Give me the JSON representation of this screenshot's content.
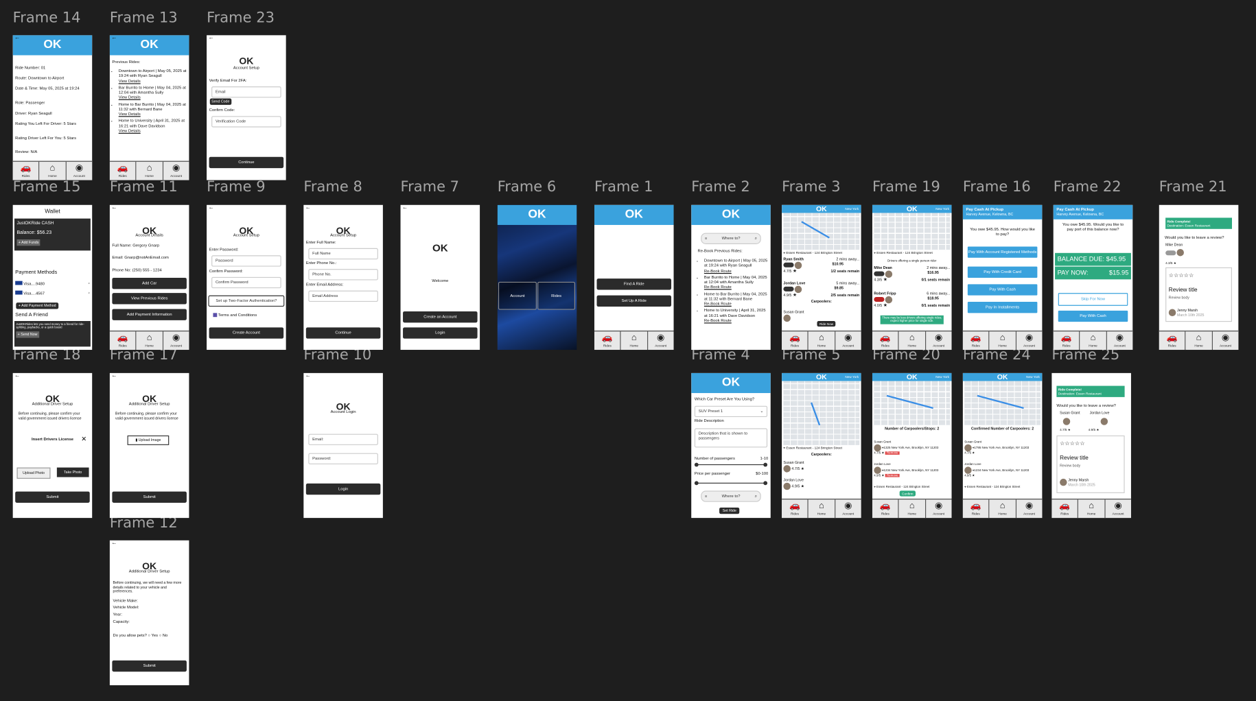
{
  "labels": {
    "f14": "Frame 14",
    "f13": "Frame 13",
    "f23": "Frame 23",
    "f15": "Frame 15",
    "f11": "Frame 11",
    "f9": "Frame 9",
    "f8": "Frame 8",
    "f7": "Frame 7",
    "f6": "Frame 6",
    "f1": "Frame 1",
    "f2": "Frame 2",
    "f3": "Frame 3",
    "f19": "Frame 19",
    "f16": "Frame 16",
    "f22": "Frame 22",
    "f21": "Frame 21",
    "f18": "Frame 18",
    "f17": "Frame 17",
    "f10": "Frame 10",
    "f4": "Frame 4",
    "f5": "Frame 5",
    "f20": "Frame 20",
    "f24": "Frame 24",
    "f25": "Frame 25",
    "f12": "Frame 12"
  },
  "nav": {
    "rides": "Rides",
    "home": "Home",
    "account": "Account"
  },
  "f14": {
    "ride_number": "Ride Number: 01",
    "route": "Route: Downtown to Airport",
    "datetime": "Date & Time: May 05, 2025 at 19:24",
    "role": "Role: Passenger",
    "driver": "Driver: Ryan Seagull",
    "rating_left": "Rating You Left For Driver: 5 Stars",
    "rating_driver": "Rating Driver Left For You: 5 Stars",
    "review": "Review: N/A"
  },
  "f13": {
    "title": "Previous Rides:",
    "rides": [
      "Downtown to Airport | May 05, 2025 at 19:24 with Ryan Seagull",
      "Bar Burrito to Home | May 04, 2025 at 12:04 with Amantha Sully",
      "Home to Bar Burrito | May 04, 2025 at 11:32 with Bernard Bane",
      "Home to University | April 31, 2025 at 16:21 with Dave Davidson"
    ],
    "view": "View Details"
  },
  "f23": {
    "title": "Account Setup",
    "verify": "Verify Email For 2FA:",
    "email_ph": "Email",
    "send": "Send Code",
    "confirm": "Confirm Code:",
    "code_ph": "Verification Code",
    "continue": "Continue"
  },
  "f15": {
    "wallet": "Wallet",
    "cash": "JustOKRide CASH",
    "balance": "Balance: $56.23",
    "add_funds": "+ Add Funds",
    "payment_methods": "Payment Methods",
    "visa1": "Visa....9480",
    "visa2": "Visa....4567",
    "add_method": "+ Add Payment Method",
    "send_friend": "Send A Friend",
    "send_desc": "JustOKRides lets you send money to a friend for ride-splitting, paybacks, or a quick boost!",
    "send_now": "+ Send Now"
  },
  "f11": {
    "title": "Account Details",
    "name": "Full Name: Gergory Gnarp",
    "email": "Email: Gnarp@notAnEmail.com",
    "phone": "Phone No: (250) 555 - 1234",
    "add_car": "Add Car",
    "view_prev": "View Previous Rides",
    "add_payment": "Add Payment Information"
  },
  "f9": {
    "title": "Account Setup",
    "enter_pw": "Enter Password:",
    "pw_ph": "Password",
    "confirm_pw": "Confirm Password:",
    "confirm_ph": "Confirm Password",
    "two_fa": "Set up Two-Factor Authentication?",
    "terms": "Terms and Conditions",
    "create": "Create Account"
  },
  "f8": {
    "title": "Account Setup",
    "name_l": "Enter Full Name:",
    "name_ph": "Full Name",
    "phone_l": "Enter Phone No.:",
    "phone_ph": "Phone No.",
    "email_l": "Enter Email Address:",
    "email_ph": "Email Address",
    "continue": "Continue"
  },
  "f7": {
    "welcome": "Welcome",
    "create": "Create an Account",
    "login": "Login"
  },
  "f6": {
    "account": "Account",
    "rides": "Rides"
  },
  "f1": {
    "find": "Find A Ride",
    "setup": "Set Up A Ride"
  },
  "f2": {
    "where": "Where to?",
    "rebook_title": "Re-Book Previous Rides:",
    "rides": [
      "Downtown to Airport | May 05, 2025 at 19:24 with Ryan Seagull",
      "Bar Burrito to Home | May 04, 2025 at 12:04 with Amantha Sully",
      "Home to Bar Burrito | May 04, 2025 at 11:32 with Bernard Bane",
      "Home to University | April 31, 2025 at 16:21 with Dave Davidson"
    ],
    "rebook": "Re-Book Route"
  },
  "f3": {
    "city": "New York",
    "dest": "Essen Restaurant - 124 Brington Street",
    "d1": "Ryan Smith",
    "d1_eta": "2 mins away...",
    "d1_price": "$10.95",
    "d1_seats": "1/2 seats remain",
    "d1_rating": "4.7/5",
    "d2": "Jordan Love",
    "d2_eta": "5 mins away...",
    "d2_price": "$9.85",
    "d2_seats": "2/5 seats remain",
    "d2_rating": "4.9/5",
    "carpoolers": "Carpoolers:",
    "c1": "Susan Grant",
    "ride_now": "Ride Now"
  },
  "f19": {
    "city": "New York",
    "dest": "Essen Restaurant - 124 Brington Street",
    "single": "Drivers offering a single person rider",
    "d1": "Mike Dean",
    "d1_eta": "2 mins away...",
    "d1_price": "$16.95",
    "d1_seats": "0/1 seats remain",
    "d1_rating": "4.3/5",
    "d2": "Robert Fripp",
    "d2_eta": "6 mins away...",
    "d2_price": "$18.95",
    "d2_seats": "0/1 seats remain",
    "d2_rating": "4.0/5",
    "note": "There may be less drivers offering single rides; expect higher price for single ride."
  },
  "f16": {
    "header1": "Pay Cash At Pickup",
    "header2": "Harvey Avenue, Kelowna, BC",
    "owe": "You owe $45.95. How would you like to pay?",
    "acct": "Pay With Account Registered Methods",
    "card": "Pay With Credit Card",
    "cash": "Pay With Cash",
    "install": "Pay In Installments"
  },
  "f22": {
    "header1": "Pay Cash At Pickup",
    "header2": "Harvey Avenue, Kelowna, BC",
    "owe": "You owe $45.95. Would you like to pay port of this balance now?",
    "due": "BALANCE DUE: $45.95",
    "pay_now": "PAY NOW:",
    "pay_amt": "$15.95",
    "skip": "Skip For Now",
    "cash": "Pay With Cash"
  },
  "f21": {
    "complete": "Ride Complete!",
    "dest": "Destination: Essen Restaurant",
    "ask": "Would you like to leave a review?",
    "driver": "Mike Dean",
    "rating": "4.3/5",
    "review_title": "Review title",
    "review_body": "Review body",
    "reviewer": "Jenny Marsh",
    "date": "March 10th 2025"
  },
  "f18": {
    "title": "Additional Driver Setup",
    "desc": "Before continuing, please confirm your valid government issued drivers license",
    "insert": "Insert Drivers License",
    "upload": "Upload Photo",
    "take": "Take Photo",
    "submit": "Submit"
  },
  "f17": {
    "title": "Additional Driver Setup",
    "desc": "Before continuing, please confirm your valid government issued drivers license",
    "upload": "Upload Image",
    "submit": "Submit"
  },
  "f10": {
    "title": "Account Login",
    "email": "Email:",
    "password": "Password:",
    "login": "Login"
  },
  "f4": {
    "preset_q": "Which Car Preset Are You Using?",
    "preset": "SUV Preset 1",
    "desc_l": "Ride Description",
    "desc": "Description that is shown to passengers",
    "num_l": "Number of passengers",
    "num_r": "1-10",
    "price_l": "Price per passenger",
    "price_r": "$0-100",
    "where": "Where to?",
    "set": "Set Ride"
  },
  "f5": {
    "city": "New York",
    "dest": "Essen Restaurant - 124 Brington Street",
    "carpoolers": "Carpoolers:",
    "c1": "Susan Grant",
    "c1_rating": "4.7/5",
    "c2": "Jordan Love",
    "c2_rating": "4.9/5"
  },
  "f20": {
    "city": "New York",
    "count": "Number of Carpoolers/Stops: 2",
    "c1": "Susan Grant",
    "c1_addr": "1325 New York Ave, Brooklyn, NY 11203",
    "c1_rating": "4.7/5",
    "c2": "Jordan Love",
    "c2_addr": "1234 New York Ave, Brooklyn, NY 11203",
    "c2_rating": "4.9/5",
    "dest": "Essen Restaurant - 124 Brington Street",
    "remove": "Remove",
    "confirm": "Confirm"
  },
  "f24": {
    "city": "New York",
    "count": "Confirmed Number of Carpoolers: 2",
    "c1": "Susan Grant",
    "c1_addr": "1795 New York Ave, Brooklyn, NY 11203",
    "c1_rating": "4.7/5",
    "c2": "Jordan Love",
    "c2_addr": "1234 New York Ave, Brooklyn, NY 11203",
    "c2_rating": "4.9/5",
    "dest": "Essen Restaurant - 124 Brington Street"
  },
  "f25": {
    "complete": "Ride Complete!",
    "dest": "Destination: Essen Restaurant",
    "ask": "Would you like to leave a review?",
    "p1": "Susan Grant",
    "p1_rating": "4.7/5",
    "p2": "Jordan Love",
    "p2_rating": "4.9/5",
    "review_title": "Review title",
    "review_body": "Review body",
    "reviewer": "Jenny Marsh",
    "date": "March 10th 2025"
  },
  "f12": {
    "title": "Additional Driver Setup",
    "desc": "Before continuing, we will need a few more details related to your vehicle and preferences.",
    "make": "Vehicle Make:",
    "model": "Vehicle Model:",
    "year": "Year:",
    "capacity": "Capacity:",
    "pets": "Do you allow pets?",
    "yes": "Yes",
    "no": "No",
    "submit": "Submit"
  },
  "colors": {
    "canvas": "#1e1e1e",
    "brand": "#3aa2dd",
    "dark_button": "#2b2b2b",
    "green": "#2eaa80",
    "remove": "#e04848"
  },
  "icons": [
    "back-arrow-icon",
    "car-icon",
    "home-icon",
    "account-icon",
    "search-icon",
    "location-pin-icon",
    "star-icon",
    "upload-icon",
    "close-icon"
  ]
}
